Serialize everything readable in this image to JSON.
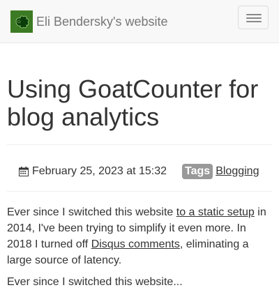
{
  "navbar": {
    "brand": "Eli Bendersky's website",
    "logo_icon": "mandelbrot-logo-icon",
    "toggle_icon": "hamburger-menu-icon"
  },
  "post": {
    "title": "Using GoatCounter for blog analytics",
    "date": "February 25, 2023 at 15:32",
    "date_icon": "calendar-icon",
    "tags_label": "Tags",
    "tags": [
      "Blogging"
    ]
  },
  "body": {
    "p1_part1": "Ever since I switched this website ",
    "p1_link1": "to a static setup",
    "p1_part2": " in 2014, I've been trying to simplify it even more. In 2018 I turned off ",
    "p1_link2": "Disqus comments",
    "p1_part3": ", eliminating a large source of latency.",
    "p2_partial": "Ever since I switched this website..."
  },
  "colors": {
    "navbar_bg": "#f8f8f8",
    "brand_text": "#777777",
    "logo_green": "#3c7a23",
    "tags_badge_bg": "#999999",
    "text": "#333333"
  }
}
